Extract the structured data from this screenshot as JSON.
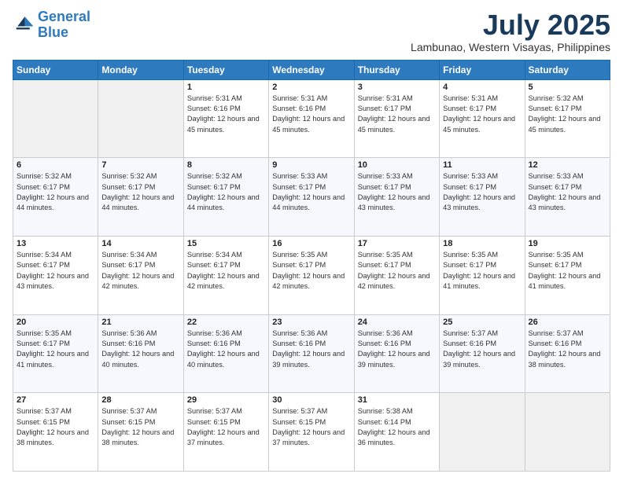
{
  "header": {
    "logo_line1": "General",
    "logo_line2": "Blue",
    "month": "July 2025",
    "location": "Lambunao, Western Visayas, Philippines"
  },
  "days_of_week": [
    "Sunday",
    "Monday",
    "Tuesday",
    "Wednesday",
    "Thursday",
    "Friday",
    "Saturday"
  ],
  "weeks": [
    [
      {
        "day": "",
        "info": ""
      },
      {
        "day": "",
        "info": ""
      },
      {
        "day": "1",
        "info": "Sunrise: 5:31 AM\nSunset: 6:16 PM\nDaylight: 12 hours and 45 minutes."
      },
      {
        "day": "2",
        "info": "Sunrise: 5:31 AM\nSunset: 6:16 PM\nDaylight: 12 hours and 45 minutes."
      },
      {
        "day": "3",
        "info": "Sunrise: 5:31 AM\nSunset: 6:17 PM\nDaylight: 12 hours and 45 minutes."
      },
      {
        "day": "4",
        "info": "Sunrise: 5:31 AM\nSunset: 6:17 PM\nDaylight: 12 hours and 45 minutes."
      },
      {
        "day": "5",
        "info": "Sunrise: 5:32 AM\nSunset: 6:17 PM\nDaylight: 12 hours and 45 minutes."
      }
    ],
    [
      {
        "day": "6",
        "info": "Sunrise: 5:32 AM\nSunset: 6:17 PM\nDaylight: 12 hours and 44 minutes."
      },
      {
        "day": "7",
        "info": "Sunrise: 5:32 AM\nSunset: 6:17 PM\nDaylight: 12 hours and 44 minutes."
      },
      {
        "day": "8",
        "info": "Sunrise: 5:32 AM\nSunset: 6:17 PM\nDaylight: 12 hours and 44 minutes."
      },
      {
        "day": "9",
        "info": "Sunrise: 5:33 AM\nSunset: 6:17 PM\nDaylight: 12 hours and 44 minutes."
      },
      {
        "day": "10",
        "info": "Sunrise: 5:33 AM\nSunset: 6:17 PM\nDaylight: 12 hours and 43 minutes."
      },
      {
        "day": "11",
        "info": "Sunrise: 5:33 AM\nSunset: 6:17 PM\nDaylight: 12 hours and 43 minutes."
      },
      {
        "day": "12",
        "info": "Sunrise: 5:33 AM\nSunset: 6:17 PM\nDaylight: 12 hours and 43 minutes."
      }
    ],
    [
      {
        "day": "13",
        "info": "Sunrise: 5:34 AM\nSunset: 6:17 PM\nDaylight: 12 hours and 43 minutes."
      },
      {
        "day": "14",
        "info": "Sunrise: 5:34 AM\nSunset: 6:17 PM\nDaylight: 12 hours and 42 minutes."
      },
      {
        "day": "15",
        "info": "Sunrise: 5:34 AM\nSunset: 6:17 PM\nDaylight: 12 hours and 42 minutes."
      },
      {
        "day": "16",
        "info": "Sunrise: 5:35 AM\nSunset: 6:17 PM\nDaylight: 12 hours and 42 minutes."
      },
      {
        "day": "17",
        "info": "Sunrise: 5:35 AM\nSunset: 6:17 PM\nDaylight: 12 hours and 42 minutes."
      },
      {
        "day": "18",
        "info": "Sunrise: 5:35 AM\nSunset: 6:17 PM\nDaylight: 12 hours and 41 minutes."
      },
      {
        "day": "19",
        "info": "Sunrise: 5:35 AM\nSunset: 6:17 PM\nDaylight: 12 hours and 41 minutes."
      }
    ],
    [
      {
        "day": "20",
        "info": "Sunrise: 5:35 AM\nSunset: 6:17 PM\nDaylight: 12 hours and 41 minutes."
      },
      {
        "day": "21",
        "info": "Sunrise: 5:36 AM\nSunset: 6:16 PM\nDaylight: 12 hours and 40 minutes."
      },
      {
        "day": "22",
        "info": "Sunrise: 5:36 AM\nSunset: 6:16 PM\nDaylight: 12 hours and 40 minutes."
      },
      {
        "day": "23",
        "info": "Sunrise: 5:36 AM\nSunset: 6:16 PM\nDaylight: 12 hours and 39 minutes."
      },
      {
        "day": "24",
        "info": "Sunrise: 5:36 AM\nSunset: 6:16 PM\nDaylight: 12 hours and 39 minutes."
      },
      {
        "day": "25",
        "info": "Sunrise: 5:37 AM\nSunset: 6:16 PM\nDaylight: 12 hours and 39 minutes."
      },
      {
        "day": "26",
        "info": "Sunrise: 5:37 AM\nSunset: 6:16 PM\nDaylight: 12 hours and 38 minutes."
      }
    ],
    [
      {
        "day": "27",
        "info": "Sunrise: 5:37 AM\nSunset: 6:15 PM\nDaylight: 12 hours and 38 minutes."
      },
      {
        "day": "28",
        "info": "Sunrise: 5:37 AM\nSunset: 6:15 PM\nDaylight: 12 hours and 38 minutes."
      },
      {
        "day": "29",
        "info": "Sunrise: 5:37 AM\nSunset: 6:15 PM\nDaylight: 12 hours and 37 minutes."
      },
      {
        "day": "30",
        "info": "Sunrise: 5:37 AM\nSunset: 6:15 PM\nDaylight: 12 hours and 37 minutes."
      },
      {
        "day": "31",
        "info": "Sunrise: 5:38 AM\nSunset: 6:14 PM\nDaylight: 12 hours and 36 minutes."
      },
      {
        "day": "",
        "info": ""
      },
      {
        "day": "",
        "info": ""
      }
    ]
  ]
}
